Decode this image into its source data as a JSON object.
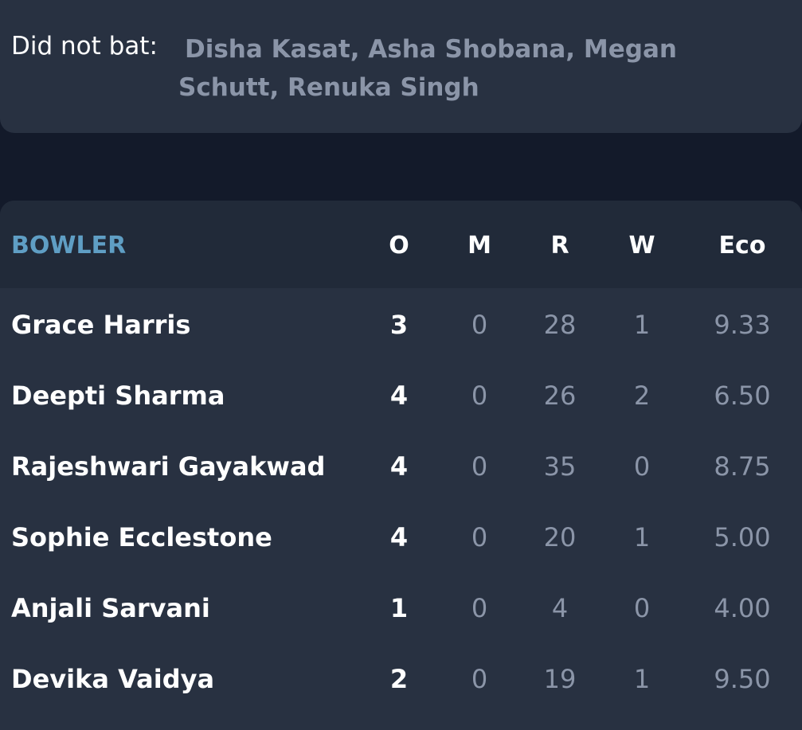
{
  "did_not_bat": {
    "label": "Did not bat:",
    "names": "Disha Kasat, Asha Shobana, Megan Schutt, Renuka Singh"
  },
  "bowling": {
    "headers": {
      "bowler": "BOWLER",
      "overs": "O",
      "maidens": "M",
      "runs": "R",
      "wickets": "W",
      "economy": "Eco"
    },
    "rows": [
      {
        "name": "Grace Harris",
        "o": "3",
        "m": "0",
        "r": "28",
        "w": "1",
        "eco": "9.33"
      },
      {
        "name": "Deepti Sharma",
        "o": "4",
        "m": "0",
        "r": "26",
        "w": "2",
        "eco": "6.50"
      },
      {
        "name": "Rajeshwari Gayakwad",
        "o": "4",
        "m": "0",
        "r": "35",
        "w": "0",
        "eco": "8.75"
      },
      {
        "name": "Sophie Ecclestone",
        "o": "4",
        "m": "0",
        "r": "20",
        "w": "1",
        "eco": "5.00"
      },
      {
        "name": "Anjali Sarvani",
        "o": "1",
        "m": "0",
        "r": "4",
        "w": "0",
        "eco": "4.00"
      },
      {
        "name": "Devika Vaidya",
        "o": "2",
        "m": "0",
        "r": "19",
        "w": "1",
        "eco": "9.50"
      }
    ]
  },
  "colors": {
    "background": "#131a2a",
    "card": "#283141",
    "header_row": "#212a39",
    "bowler_header": "#5f9ec4",
    "muted_text": "#8b95a8",
    "primary_text": "#ffffff"
  }
}
